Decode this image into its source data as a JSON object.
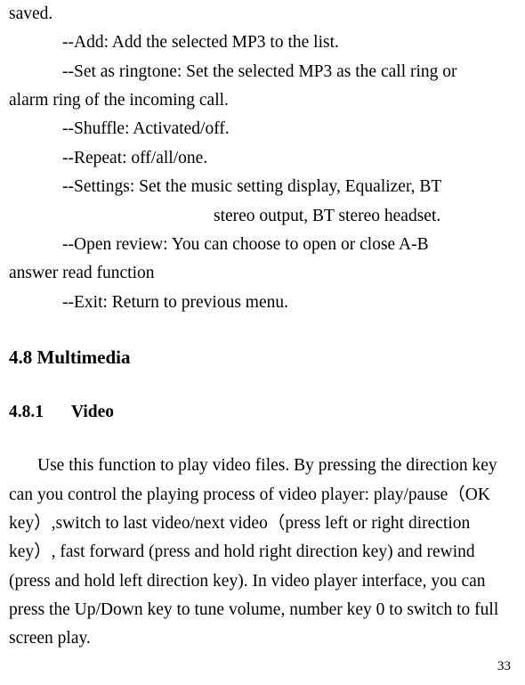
{
  "lines": {
    "saved": "saved.",
    "add": "--Add: Add the selected MP3 to the list.",
    "ringtone": "--Set as ringtone: Set the selected MP3 as the call ring or",
    "ringtone2": "alarm ring of the incoming call.",
    "shuffle": "--Shuffle: Activated/off.",
    "repeat": "--Repeat: off/all/one.",
    "settings": "--Settings: Set the music setting display, Equalizer, BT",
    "settings2": "stereo output, BT stereo headset.",
    "openreview": "--Open review: You can choose to open or close A-B",
    "openreview2": "answer read function",
    "exit": "--Exit: Return to previous menu."
  },
  "headings": {
    "multimedia": "4.8 Multimedia",
    "video_num": "4.8.1",
    "video_label": "Video"
  },
  "body": {
    "video": "Use this function to play video files. By pressing the direction key can you control the playing process of video player: play/pause（OK key）,switch to last video/next video（press left or right direction key）, fast forward (press and hold right direction key) and rewind (press and hold left direction key). In video player interface, you can press the Up/Down key to tune volume, number key 0 to switch to full screen play."
  },
  "page_number": "33"
}
